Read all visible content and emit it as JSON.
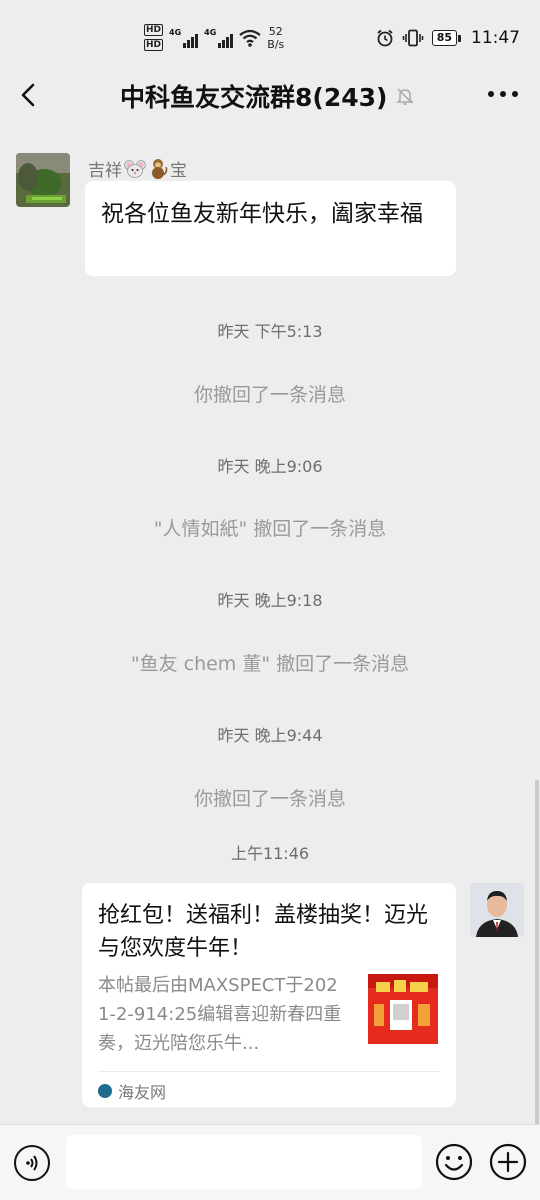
{
  "status_bar": {
    "hd1": "HD",
    "hd2": "HD",
    "net1": "4G",
    "net2": "4G",
    "speed_value": "52",
    "speed_unit": "B/s",
    "battery": "85",
    "time": "11:47"
  },
  "header": {
    "title": "中科鱼友交流群8(243)"
  },
  "messages": {
    "sender_name_prefix": "吉祥",
    "sender_name_suffix": "宝",
    "greeting": "祝各位鱼友新年快乐，阖家幸福",
    "time1": "昨天 下午5:13",
    "recall1": "你撤回了一条消息",
    "time2": "昨天 晚上9:06",
    "recall2": "\"人情如紙\" 撤回了一条消息",
    "time3": "昨天 晚上9:18",
    "recall3": "\"鱼友 chem 董\" 撤回了一条消息",
    "time4": "昨天 晚上9:44",
    "recall4": "你撤回了一条消息",
    "time5": "上午11:46"
  },
  "card": {
    "title": "抢红包！送福利！盖楼抽奖！迈光与您欢度牛年！",
    "description": "本帖最后由MAXSPECT于2021-2-914:25编辑喜迎新春四重奏，迈光陪您乐牛...",
    "source": "海友网"
  },
  "colors": {
    "background": "#ededed",
    "bubble": "#ffffff",
    "thumb_red": "#e52b1e"
  }
}
